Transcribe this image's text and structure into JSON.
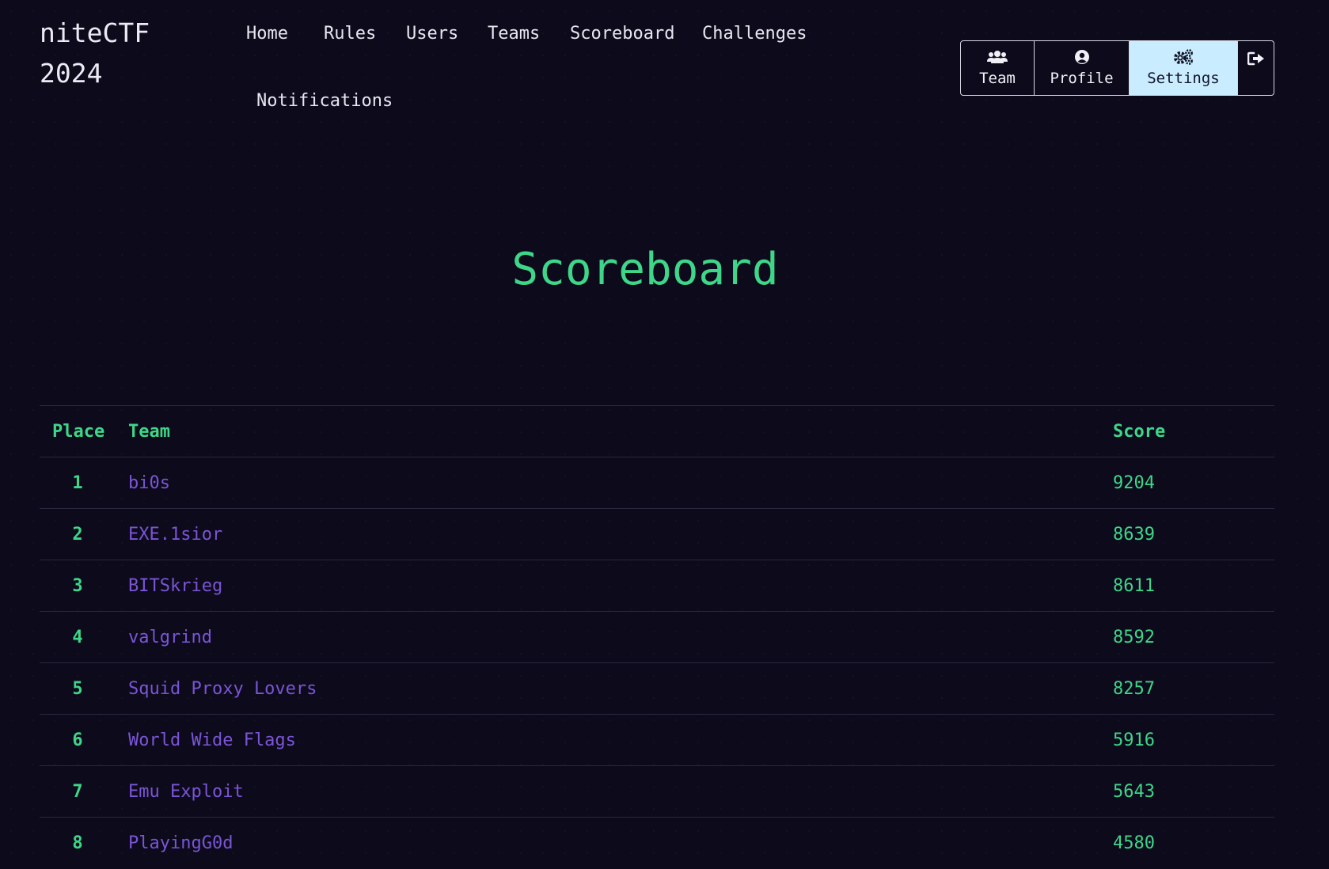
{
  "brand": {
    "line1": "niteCTF",
    "line2": "2024"
  },
  "nav": {
    "home": "Home",
    "rules": "Rules",
    "users": "Users",
    "teams": "Teams",
    "scoreboard": "Scoreboard",
    "challenges": "Challenges",
    "notifications": "Notifications"
  },
  "user_menu": {
    "team": "Team",
    "profile": "Profile",
    "settings": "Settings",
    "active": "Settings"
  },
  "icons": {
    "team": "users-icon",
    "profile": "user-circle-icon",
    "settings": "cogs-icon",
    "logout": "sign-out-icon"
  },
  "colors": {
    "background": "#0d0a1c",
    "accent_green": "#3ed688",
    "team_link": "#7a55d6",
    "active_button": "#c9ecff"
  },
  "page": {
    "title": "Scoreboard"
  },
  "table": {
    "headers": {
      "place": "Place",
      "team": "Team",
      "score": "Score"
    },
    "rows": [
      {
        "place": "1",
        "team": "bi0s",
        "score": "9204"
      },
      {
        "place": "2",
        "team": "EXE.1sior",
        "score": "8639"
      },
      {
        "place": "3",
        "team": "BITSkrieg",
        "score": "8611"
      },
      {
        "place": "4",
        "team": "valgrind",
        "score": "8592"
      },
      {
        "place": "5",
        "team": "Squid Proxy Lovers",
        "score": "8257"
      },
      {
        "place": "6",
        "team": "World Wide Flags",
        "score": "5916"
      },
      {
        "place": "7",
        "team": "Emu Exploit",
        "score": "5643"
      },
      {
        "place": "8",
        "team": "PlayingG0d",
        "score": "4580"
      }
    ]
  }
}
